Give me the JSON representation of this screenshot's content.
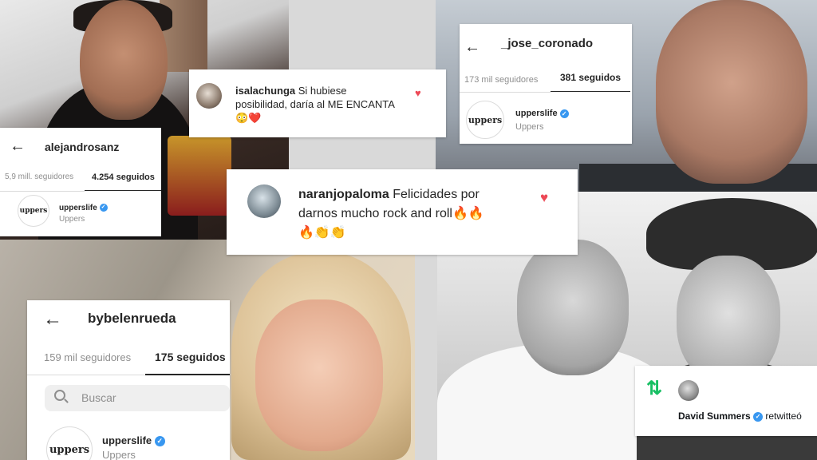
{
  "profiles": {
    "sanz": {
      "handle": "alejandrosanz",
      "followers": "5,9 mill. seguidores",
      "following": "4.254 seguidos",
      "account_name": "upperslife",
      "account_sub": "Uppers",
      "avatar_text": "uppers"
    },
    "coronado": {
      "handle": "_jose_coronado",
      "followers": "173 mil seguidores",
      "following": "381 seguidos",
      "account_name": "upperslife",
      "account_sub": "Uppers",
      "avatar_text": "uppers"
    },
    "rueda": {
      "handle": "bybelenrueda",
      "followers": "159 mil seguidores",
      "following": "175 seguidos",
      "search_placeholder": "Buscar",
      "account_name": "upperslife",
      "account_sub": "Uppers",
      "avatar_text": "uppers"
    }
  },
  "comments": {
    "isala": {
      "user": "isalachunga",
      "text_line1": "Si hubiese",
      "text_line2": "posibilidad, daría al ME ENCANTA",
      "emojis": "😳❤️"
    },
    "naranjo": {
      "user": "naranjopaloma",
      "text_line1": "Felicidades por",
      "text_line2": "darnos mucho rock and roll🔥🔥",
      "emojis": "🔥👏👏"
    }
  },
  "twitter": {
    "user": "David Summers",
    "action": "retwitteó"
  },
  "icons": {
    "back": "arrow-left-icon",
    "verified": "verified-badge-icon",
    "heart": "heart-icon",
    "search": "search-icon",
    "retweet": "retweet-icon"
  },
  "colors": {
    "verified": "#3897f0",
    "heart": "#ed4956",
    "retweet": "#17bf63",
    "muted_text": "#8e8e8e"
  }
}
